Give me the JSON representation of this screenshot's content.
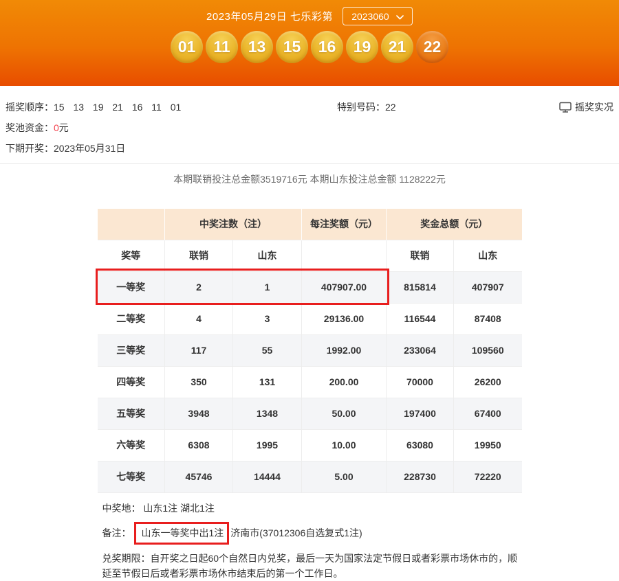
{
  "colors": {
    "header_gradient_top": "#f18a06",
    "header_gradient_bottom": "#e84d00",
    "ball_gold": "#eab52a",
    "special_ball_orange": "#ea7d18",
    "table_header_bg": "#fbe7d2",
    "zebra_row_bg": "#f4f5f7",
    "highlight_red": "#e81e1e",
    "pool_amount_red": "#f4404c"
  },
  "header": {
    "title": "2023年05月29日 七乐彩第",
    "issue": "2023060",
    "balls": [
      "01",
      "11",
      "13",
      "15",
      "16",
      "19",
      "21"
    ],
    "special_ball": "22"
  },
  "info": {
    "draw_order_label": "摇奖顺序：",
    "draw_order_value": "15 13 19 21 16 11 01",
    "special_number_label": "特别号码：",
    "special_number_value": "22",
    "live_draw_label": "摇奖实况",
    "pool_label": "奖池资金：",
    "pool_value": "0",
    "pool_unit": "元",
    "next_draw_label": "下期开奖：",
    "next_draw_value": "2023年05月31日"
  },
  "summary_text": "本期联销投注总金额3519716元 本期山东投注总金额 1128222元",
  "table": {
    "group_headers": {
      "counts": "中奖注数（注）",
      "per_prize": "每注奖额（元）",
      "total_prize": "奖金总额（元）"
    },
    "sub_headers": {
      "level": "奖等",
      "lianxiao_counts": "联销",
      "shandong_counts": "山东",
      "blank": "",
      "lianxiao_total": "联销",
      "shandong_total": "山东"
    },
    "rows": [
      {
        "cells": [
          "一等奖",
          "2",
          "1",
          "407907.00",
          "815814",
          "407907"
        ],
        "highlighted": true
      },
      {
        "cells": [
          "二等奖",
          "4",
          "3",
          "29136.00",
          "116544",
          "87408"
        ],
        "highlighted": false
      },
      {
        "cells": [
          "三等奖",
          "117",
          "55",
          "1992.00",
          "233064",
          "109560"
        ],
        "highlighted": false
      },
      {
        "cells": [
          "四等奖",
          "350",
          "131",
          "200.00",
          "70000",
          "26200"
        ],
        "highlighted": false
      },
      {
        "cells": [
          "五等奖",
          "3948",
          "1348",
          "50.00",
          "197400",
          "67400"
        ],
        "highlighted": false
      },
      {
        "cells": [
          "六等奖",
          "6308",
          "1995",
          "10.00",
          "63080",
          "19950"
        ],
        "highlighted": false
      },
      {
        "cells": [
          "七等奖",
          "45746",
          "14444",
          "5.00",
          "228730",
          "72220"
        ],
        "highlighted": false
      }
    ]
  },
  "footer": {
    "winning_place_label": "中奖地：",
    "winning_place_value": "山东1注 湖北1注",
    "note_label": "备注：",
    "note_highlighted": "山东一等奖中出1注",
    "note_rest": "济南市(37012306自选复式1注)",
    "deadline_label": "兑奖期限：",
    "deadline_text": "自开奖之日起60个自然日内兑奖，最后一天为国家法定节假日或者彩票市场休市的，顺延至节假日后或者彩票市场休市结束后的第一个工作日。"
  }
}
